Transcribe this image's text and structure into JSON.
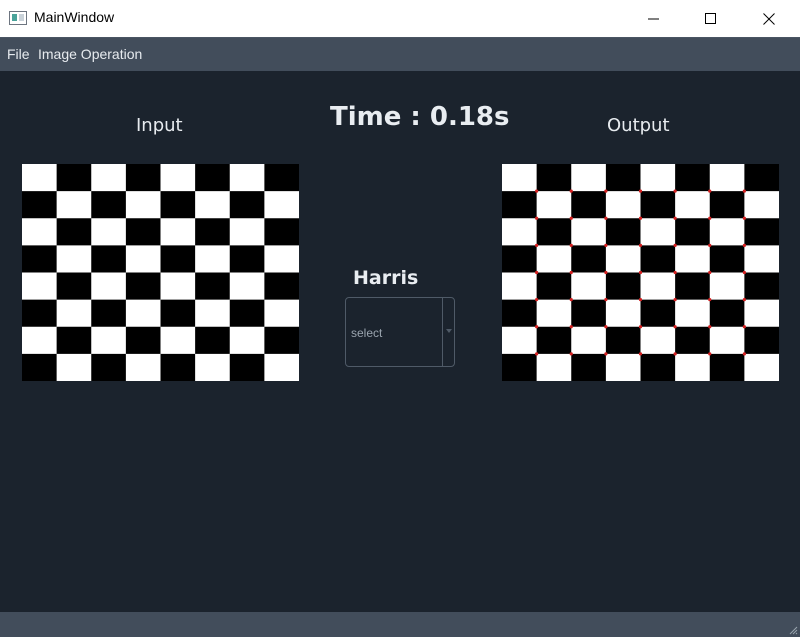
{
  "window": {
    "title": "MainWindow"
  },
  "menubar": {
    "items": [
      "File",
      "Image Operation"
    ]
  },
  "main": {
    "input_label": "Input",
    "output_label": "Output",
    "time_text": "Time : 0.18s",
    "harris_label": "Harris",
    "combo": {
      "selected": "select"
    }
  },
  "images": {
    "board_cols": 8,
    "board_rows": 8,
    "board_colors": [
      "#ffffff",
      "#000000"
    ],
    "corner_marker_color": "#d42020"
  }
}
